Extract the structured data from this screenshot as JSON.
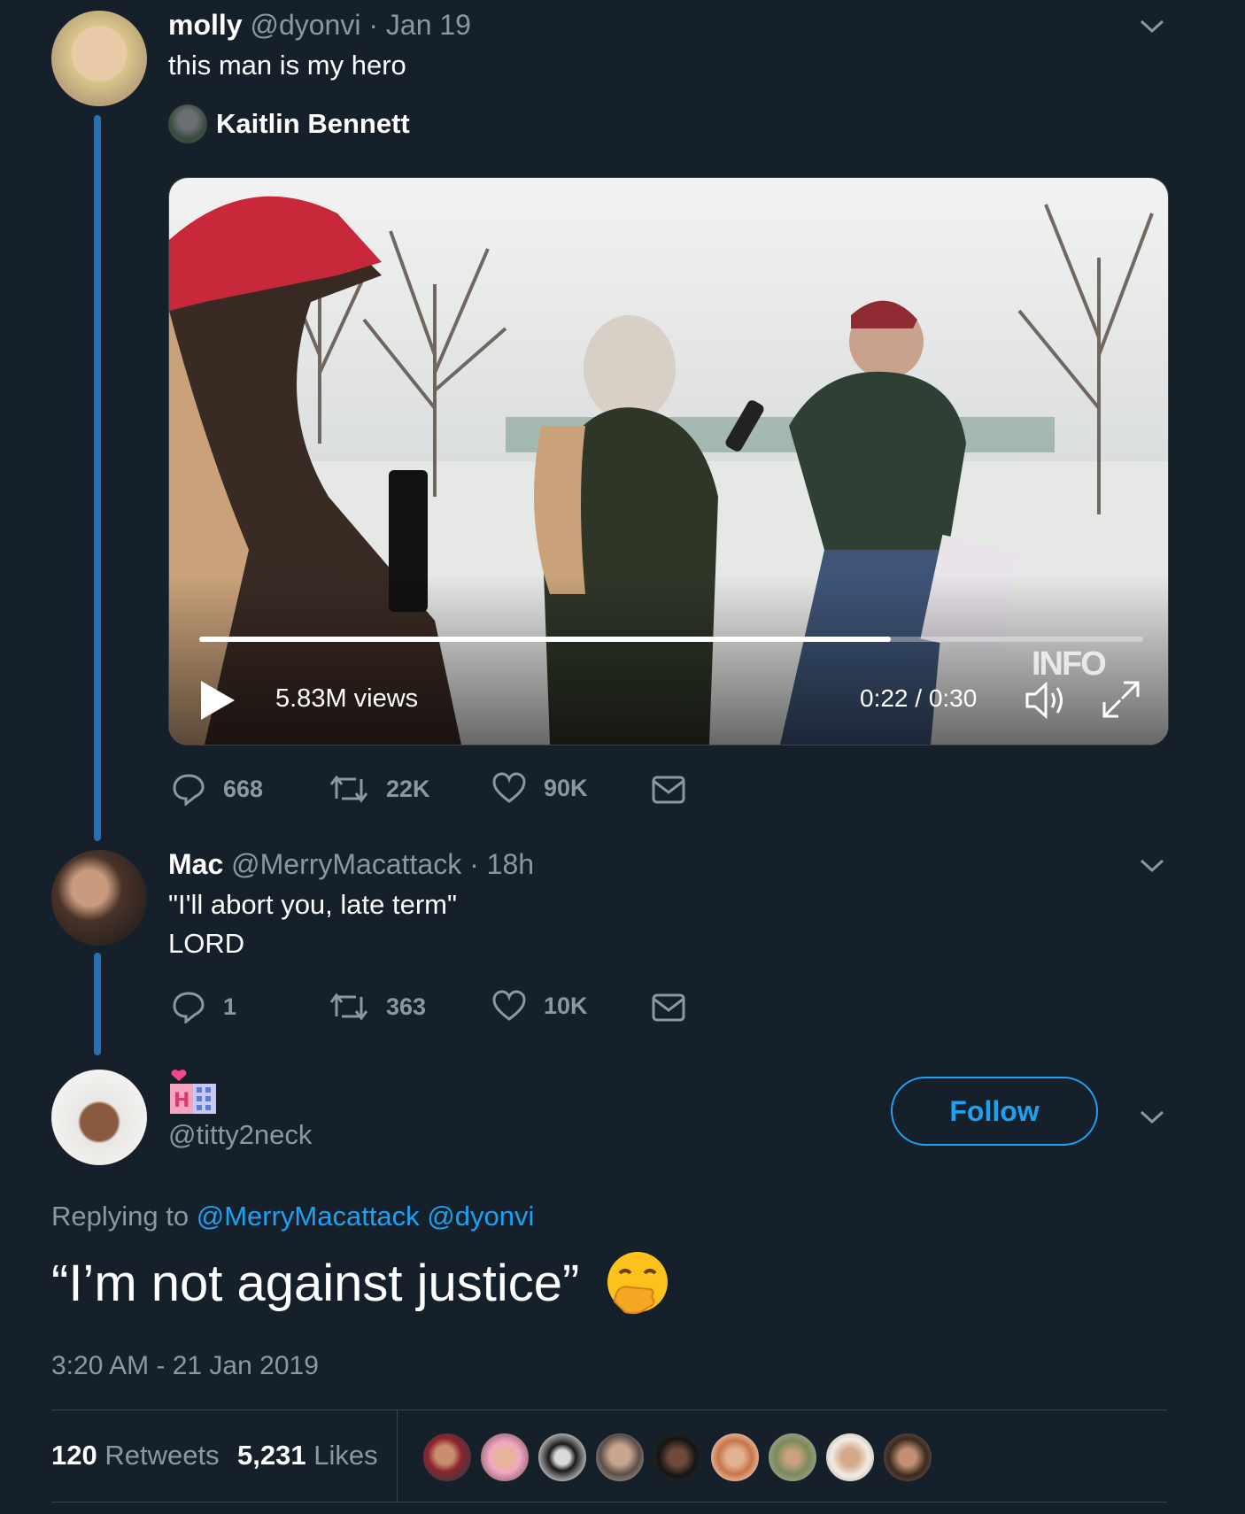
{
  "thread": [
    {
      "name": "molly",
      "handle": "@dyonvi",
      "time": "· Jan 19",
      "text": "this man is my hero",
      "quoted_account": "Kaitlin Bennett",
      "video": {
        "views": "5.83M views",
        "time": "0:22 / 0:30",
        "progress": 0.733,
        "watermark": "INFO"
      },
      "actions": {
        "replies": "668",
        "retweets": "22K",
        "likes": "90K"
      }
    },
    {
      "name": "Mac",
      "handle": "@MerryMacattack",
      "time": "· 18h",
      "text_lines": [
        "\"I'll abort you, late term\"",
        "LORD"
      ],
      "actions": {
        "replies": "1",
        "retweets": "363",
        "likes": "10K"
      }
    }
  ],
  "main_tweet": {
    "display_name_icon": "love-hotel-emoji",
    "handle": "@titty2neck",
    "follow_label": "Follow",
    "replying_prefix": "Replying to",
    "replying_to": [
      "@MerryMacattack",
      "@dyonvi"
    ],
    "text": "“I’m not against justice”",
    "emoji": "face-with-hand-over-mouth-emoji",
    "timestamp": "3:20 AM - 21 Jan 2019",
    "retweets_count": "120",
    "retweets_label": "Retweets",
    "likes_count": "5,231",
    "likes_label": "Likes"
  },
  "colors": {
    "background": "#15202b",
    "accent": "#1da1f2",
    "muted": "#8899a6",
    "thread_line": "#2a6fae"
  }
}
